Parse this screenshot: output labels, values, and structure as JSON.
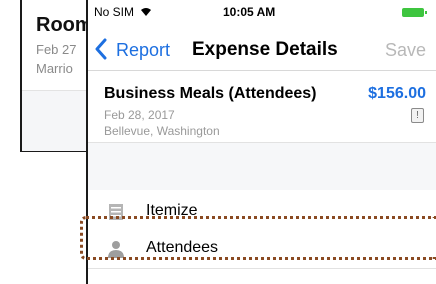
{
  "background_screen": {
    "title": "Room",
    "date": "Feb 27",
    "place": "Marrio"
  },
  "status_bar": {
    "carrier": "No SIM",
    "time": "10:05 AM",
    "wifi_icon": "wifi-icon",
    "battery_icon": "battery-icon",
    "battery_color": "#3ec53f"
  },
  "nav": {
    "back_label": "Report",
    "title": "Expense Details",
    "save_label": "Save",
    "accent": "#1d6fe0"
  },
  "expense": {
    "name": "Business Meals (Attendees)",
    "amount": "$156.00",
    "date": "Feb 28, 2017",
    "place": "Bellevue, Washington",
    "warn_glyph": "!"
  },
  "rows": {
    "itemize": "Itemize",
    "attendees": "Attendees"
  },
  "highlight_color": "#8a4a22"
}
